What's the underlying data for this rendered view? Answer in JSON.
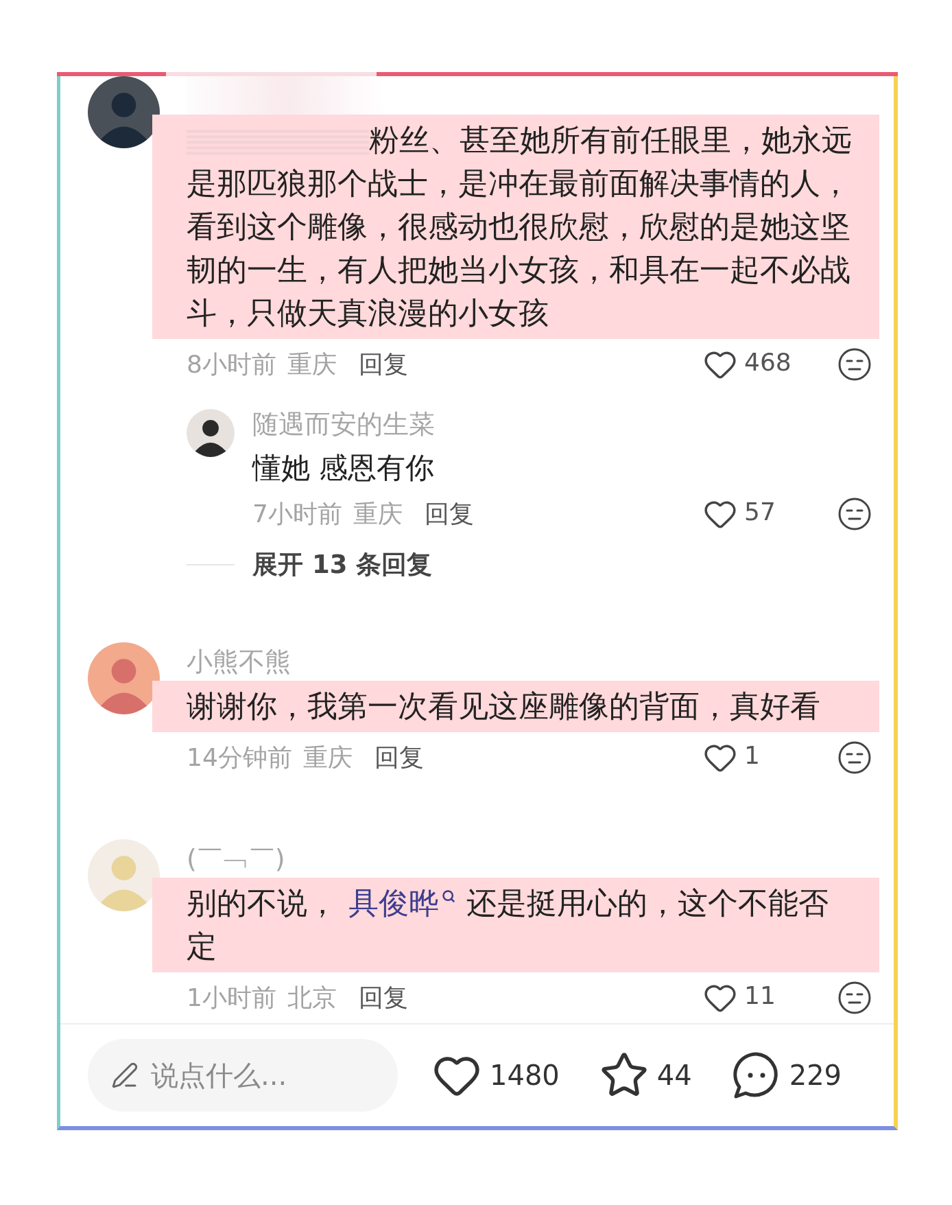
{
  "comments": [
    {
      "author_blurred": true,
      "segments": [
        {
          "text": "粉丝、甚至她所有前任眼里，她永远是那匹狼那个战士，是冲在最前面解决事情的人，看到这个雕像，很感动也很欣慰，欣慰的是她这坚韧的一生，有人把她当小女孩，和具在一起不必战斗，只做天真浪漫的小女孩"
        }
      ],
      "text_blurred_start": true,
      "highlighted": true,
      "time": "8小时前",
      "location": "重庆",
      "reply": "回复",
      "likes": "468",
      "replies": [
        {
          "author": "随遇而安的生菜",
          "segments": [
            {
              "text": "懂她 感恩有你"
            }
          ],
          "highlighted": false,
          "time": "7小时前",
          "location": "重庆",
          "reply": "回复",
          "likes": "57"
        }
      ],
      "expand": "展开 13 条回复"
    },
    {
      "author": "小熊不熊",
      "segments": [
        {
          "text": "谢谢你，我第一次看见这座雕像的背面，真好看"
        }
      ],
      "highlighted": true,
      "time": "14分钟前",
      "location": "重庆",
      "reply": "回复",
      "likes": "1"
    },
    {
      "author": "(￣﹁￣)",
      "segments": [
        {
          "text": "别的不说，"
        },
        {
          "text": "具俊晔",
          "kind": "mention"
        },
        {
          "text": "还是挺用心的，这个不能否定"
        }
      ],
      "highlighted": true,
      "time": "1小时前",
      "location": "北京",
      "reply": "回复",
      "likes": "11"
    }
  ],
  "bottom_bar": {
    "placeholder": "说点什么...",
    "likes": "1480",
    "stars": "44",
    "comments": "229"
  }
}
